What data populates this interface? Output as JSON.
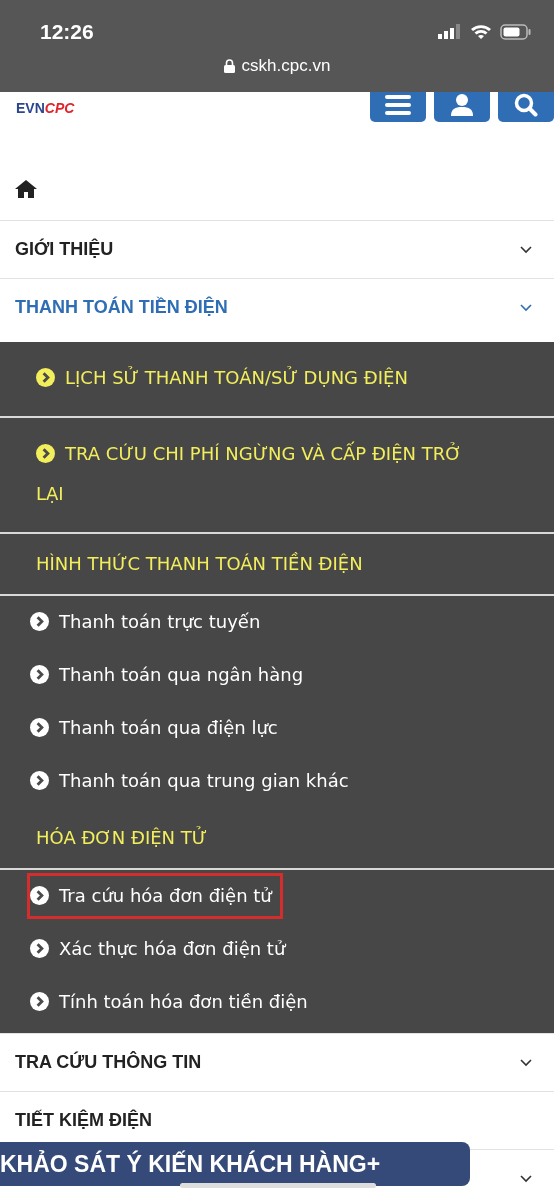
{
  "status_bar": {
    "time": "12:26",
    "url": "cskh.cpc.vn"
  },
  "header": {
    "logo_left": "EVN",
    "logo_right": "CPC"
  },
  "menu": [
    {
      "label": "GIỚI THIỆU",
      "selected": false,
      "chevron": true
    },
    {
      "label": "THANH TOÁN TIỀN ĐIỆN",
      "selected": true,
      "chevron": true,
      "children": [
        {
          "kind": "link",
          "label": "LỊCH SỬ THANH TOÁN/SỬ DỤNG ĐIỆN",
          "highlighted": false
        },
        {
          "kind": "link",
          "label": "TRA CỨU CHI PHÍ NGỪNG VÀ CẤP ĐIỆN TRỞ LẠI",
          "highlighted": false
        },
        {
          "kind": "heading",
          "label": "HÌNH THỨC THANH TOÁN TIỀN ĐIỆN",
          "highlighted": false
        },
        {
          "kind": "sublink",
          "label": "Thanh toán trực tuyến",
          "highlighted": false
        },
        {
          "kind": "sublink",
          "label": "Thanh toán qua ngân hàng",
          "highlighted": false
        },
        {
          "kind": "sublink",
          "label": "Thanh toán qua điện lực",
          "highlighted": false
        },
        {
          "kind": "sublink",
          "label": "Thanh toán qua trung gian khác",
          "highlighted": false
        },
        {
          "kind": "heading",
          "label": "HÓA ĐƠN ĐIỆN TỬ",
          "highlighted": false
        },
        {
          "kind": "sublink",
          "label": "Tra cứu hóa đơn điện tử",
          "highlighted": true
        },
        {
          "kind": "sublink",
          "label": "Xác thực hóa đơn điện tử",
          "highlighted": false
        },
        {
          "kind": "sublink",
          "label": "Tính toán hóa đơn tiền điện",
          "highlighted": false
        }
      ]
    },
    {
      "label": "TRA CỨU THÔNG TIN",
      "selected": false,
      "chevron": true
    },
    {
      "label": "TIẾT KIỆM ĐIỆN",
      "selected": false,
      "chevron": false
    },
    {
      "selected": false,
      "chevron": true
    }
  ],
  "survey_banner": "KHẢO SÁT Ý KIẾN KHÁCH HÀNG+"
}
